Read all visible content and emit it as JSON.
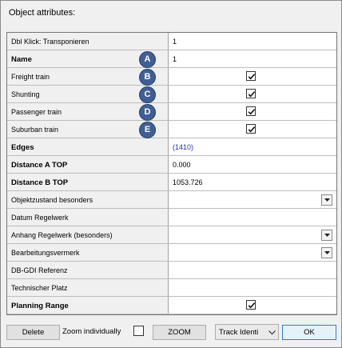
{
  "dialog": {
    "title": "Object attributes:"
  },
  "rows": [
    {
      "label": "Dbl Klick: Transponieren",
      "bold": false,
      "value": "1",
      "badge": null,
      "checked": false,
      "dropdown": false
    },
    {
      "label": "Name",
      "bold": true,
      "value": "1",
      "badge": "A",
      "checked": false,
      "dropdown": false
    },
    {
      "label": "Freight train",
      "bold": false,
      "value": null,
      "badge": "B",
      "checked": true,
      "dropdown": false
    },
    {
      "label": "Shunting",
      "bold": false,
      "value": null,
      "badge": "C",
      "checked": true,
      "dropdown": false
    },
    {
      "label": "Passenger train",
      "bold": false,
      "value": null,
      "badge": "D",
      "checked": true,
      "dropdown": false
    },
    {
      "label": "Suburban train",
      "bold": false,
      "value": null,
      "badge": "E",
      "checked": true,
      "dropdown": false
    },
    {
      "label": "Edges",
      "bold": true,
      "value": "(1410)",
      "link": true,
      "badge": null,
      "checked": false,
      "dropdown": false
    },
    {
      "label": "Distance A TOP",
      "bold": true,
      "value": "0.000",
      "badge": null,
      "checked": false,
      "dropdown": false
    },
    {
      "label": "Distance B TOP",
      "bold": true,
      "value": "1053.726",
      "badge": null,
      "checked": false,
      "dropdown": false
    },
    {
      "label": "Objektzustand besonders",
      "bold": false,
      "value": "",
      "badge": null,
      "checked": false,
      "dropdown": true
    },
    {
      "label": "Datum Regelwerk",
      "bold": false,
      "value": "",
      "badge": null,
      "checked": false,
      "dropdown": false
    },
    {
      "label": "Anhang Regelwerk (besonders)",
      "bold": false,
      "value": "",
      "badge": null,
      "checked": false,
      "dropdown": true
    },
    {
      "label": "Bearbeitungsvermerk",
      "bold": false,
      "value": "",
      "badge": null,
      "checked": false,
      "dropdown": true
    },
    {
      "label": "DB-GDI Referenz",
      "bold": false,
      "value": "",
      "badge": null,
      "checked": false,
      "dropdown": false
    },
    {
      "label": "Technischer Platz",
      "bold": false,
      "value": "",
      "badge": null,
      "checked": false,
      "dropdown": false
    },
    {
      "label": "Planning Range",
      "bold": true,
      "value": null,
      "badge": null,
      "checked": true,
      "dropdown": false
    }
  ],
  "footer": {
    "delete_label": "Delete",
    "zoom_individually_label": "Zoom individually",
    "zoom_individually_checked": false,
    "zoom_label": "ZOOM",
    "track_select_value": "Track Identi",
    "ok_label": "OK"
  },
  "colors": {
    "badge_fill": "#3f5f95",
    "link_value": "#1a35b0",
    "ok_border": "#2f7bd6"
  }
}
